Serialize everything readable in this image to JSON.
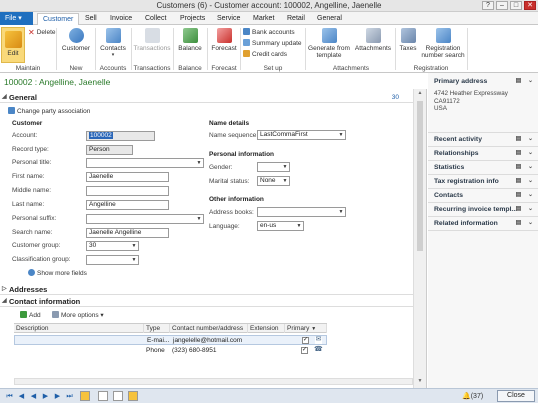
{
  "window": {
    "title": "Customers (6) - Customer account: 100002, Angelline, Jaenelle",
    "help": "?",
    "minimize": "–",
    "maximize": "□",
    "close": "✕"
  },
  "ribbon_tabs": [
    "File",
    "Customer",
    "Sell",
    "Invoice",
    "Collect",
    "Projects",
    "Service",
    "Market",
    "Retail",
    "General"
  ],
  "ribbon": {
    "edit": "Edit",
    "delete": "Delete",
    "customer": "Customer",
    "contacts": "Contacts",
    "transactions": "Transactions",
    "balance": "Balance",
    "forecast": "Forecast",
    "bank_accounts": "Bank accounts",
    "summary_update": "Summary update",
    "credit_cards": "Credit cards",
    "generate_from_template": "Generate from template",
    "attachments": "Attachments",
    "taxes": "Taxes",
    "registration_number_search": "Registration number search",
    "groups": {
      "maintain": "Maintain",
      "new": "New",
      "accounts": "Accounts",
      "transactions": "Transactions",
      "balance": "Balance",
      "forecast": "Forecast",
      "setup": "Set up",
      "attachments": "Attachments",
      "registration": "Registration"
    }
  },
  "record_title": "100002 : Angelline, Jaenelle",
  "general": {
    "header": "General",
    "change_party": "Change party association",
    "count": "30",
    "customer_heading": "Customer",
    "fields": {
      "account_label": "Account:",
      "account_value": "100002",
      "record_type_label": "Record type:",
      "record_type_value": "Person",
      "personal_title_label": "Personal title:",
      "personal_title_value": "",
      "first_name_label": "First name:",
      "first_name_value": "Jaenelle",
      "middle_name_label": "Middle name:",
      "middle_name_value": "",
      "last_name_label": "Last name:",
      "last_name_value": "Angelline",
      "personal_suffix_label": "Personal suffix:",
      "personal_suffix_value": "",
      "search_name_label": "Search name:",
      "search_name_value": "Jaenelle Angelline",
      "customer_group_label": "Customer group:",
      "customer_group_value": "30",
      "classification_group_label": "Classification group:",
      "classification_group_value": ""
    },
    "show_more": "Show more fields",
    "name_details_heading": "Name details",
    "name_sequence_label": "Name sequence:",
    "name_sequence_value": "LastCommaFirst",
    "personal_info_heading": "Personal information",
    "gender_label": "Gender:",
    "gender_value": "",
    "marital_status_label": "Marital status:",
    "marital_status_value": "None",
    "other_info_heading": "Other information",
    "address_books_label": "Address books:",
    "address_books_value": "",
    "language_label": "Language:",
    "language_value": "en-us"
  },
  "addresses_header": "Addresses",
  "contact_info": {
    "header": "Contact information",
    "add": "Add",
    "more_options": "More options",
    "columns": [
      "Description",
      "Type",
      "Contact number/address",
      "Extension",
      "Primary"
    ],
    "rows": [
      {
        "description": "",
        "type": "E-mai...",
        "contact": "jangelelle@hotmail.com",
        "extension": "",
        "primary": "✓"
      },
      {
        "description": "",
        "type": "Phone",
        "contact": "(323) 680-8951",
        "extension": "",
        "primary": "✓"
      }
    ]
  },
  "right_pane": {
    "primary_address_heading": "Primary address",
    "address_lines": [
      "4742 Heather Expressway",
      "CA91172",
      "USA"
    ],
    "items": [
      "Recent activity",
      "Relationships",
      "Statistics",
      "Tax registration info",
      "Contacts",
      "Recurring invoice templ...",
      "Related information"
    ]
  },
  "status_bar": {
    "notifications": "(37)",
    "close": "Close"
  },
  "colors": {
    "accent": "#1f6fbf",
    "title_green": "#2a7a2a"
  }
}
